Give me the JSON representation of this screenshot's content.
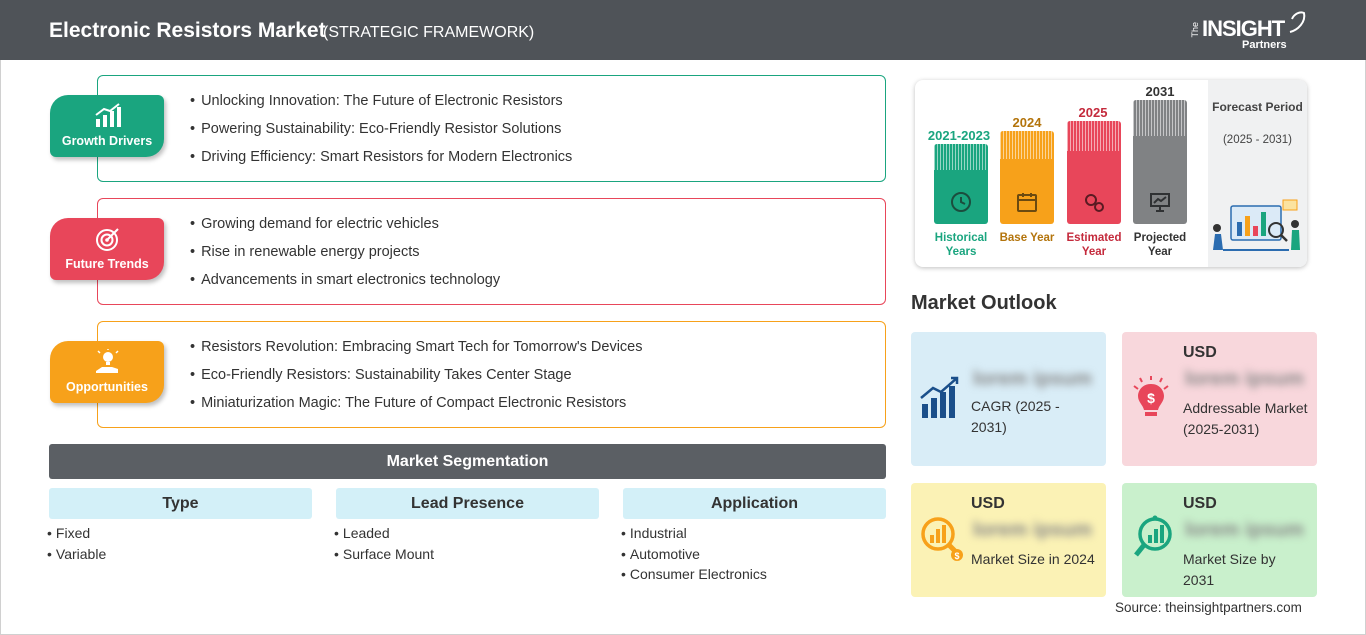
{
  "header": {
    "title": "Electronic Resistors Market",
    "subtitle": "(STRATEGIC FRAMEWORK)",
    "logo": {
      "the": "The",
      "insight": "INSIGHT",
      "partners": "Partners"
    }
  },
  "colors": {
    "green": "#1aa57f",
    "red": "#e8465a",
    "orange": "#f7a11a",
    "gray": "#808284"
  },
  "framework": [
    {
      "label": "Growth Drivers",
      "icon": "growth-chart-icon",
      "color": "#1aa57f",
      "items": [
        "Unlocking Innovation: The Future of Electronic Resistors",
        "Powering Sustainability: Eco-Friendly Resistor Solutions",
        "Driving Efficiency: Smart Resistors for Modern Electronics"
      ]
    },
    {
      "label": "Future Trends",
      "icon": "target-icon",
      "color": "#e8465a",
      "items": [
        "Growing demand for electric vehicles",
        "Rise in renewable energy projects",
        "Advancements in smart electronics technology"
      ]
    },
    {
      "label": "Opportunities",
      "icon": "lightbulb-hand-icon",
      "color": "#f7a11a",
      "items": [
        "Resistors Revolution: Embracing Smart Tech for Tomorrow's Devices",
        "Eco-Friendly Resistors: Sustainability Takes Center Stage",
        "Miniaturization Magic: The Future of Compact Electronic Resistors"
      ]
    }
  ],
  "segmentation": {
    "title": "Market Segmentation",
    "columns": [
      {
        "title": "Type",
        "items": [
          "Fixed",
          "Variable"
        ]
      },
      {
        "title": "Lead Presence",
        "items": [
          "Leaded",
          "Surface Mount"
        ]
      },
      {
        "title": "Application",
        "items": [
          "Industrial",
          "Automotive",
          "Consumer Electronics"
        ]
      }
    ]
  },
  "timeline": {
    "bars": [
      {
        "year": "2021-2023",
        "caption": "Historical Years",
        "color": "#1aa57f",
        "icon": "history-icon"
      },
      {
        "year": "2024",
        "caption": "Base Year",
        "color": "#f7a11a",
        "icon": "calendar-icon"
      },
      {
        "year": "2025",
        "caption": "Estimated Year",
        "color": "#e8465a",
        "icon": "gears-icon"
      },
      {
        "year": "2031",
        "caption": "Projected Year",
        "color": "#808284",
        "icon": "presentation-icon"
      }
    ],
    "forecast_label": "Forecast Period",
    "forecast_range": "(2025 - 2031)"
  },
  "outlook": {
    "title": "Market Outlook",
    "cards": [
      {
        "usd": "",
        "value": "lorem ipsum",
        "desc": "CAGR (2025 - 2031)",
        "icon": "bar-growth-icon",
        "bg": "#d9edf7"
      },
      {
        "usd": "USD",
        "value": "lorem ipsum",
        "desc": "Addressable Market (2025-2031)",
        "icon": "dollar-bulb-icon",
        "bg": "#f8d7dc"
      },
      {
        "usd": "USD",
        "value": "lorem ipsum",
        "desc": "Market Size in 2024",
        "icon": "magnifier-chart-icon",
        "bg": "#fbf2b5"
      },
      {
        "usd": "USD",
        "value": "lorem ipsum",
        "desc": "Market Size by 2031",
        "icon": "magnifier-growth-icon",
        "bg": "#c9f0cc"
      }
    ]
  },
  "source": "Source: theinsightpartners.com"
}
